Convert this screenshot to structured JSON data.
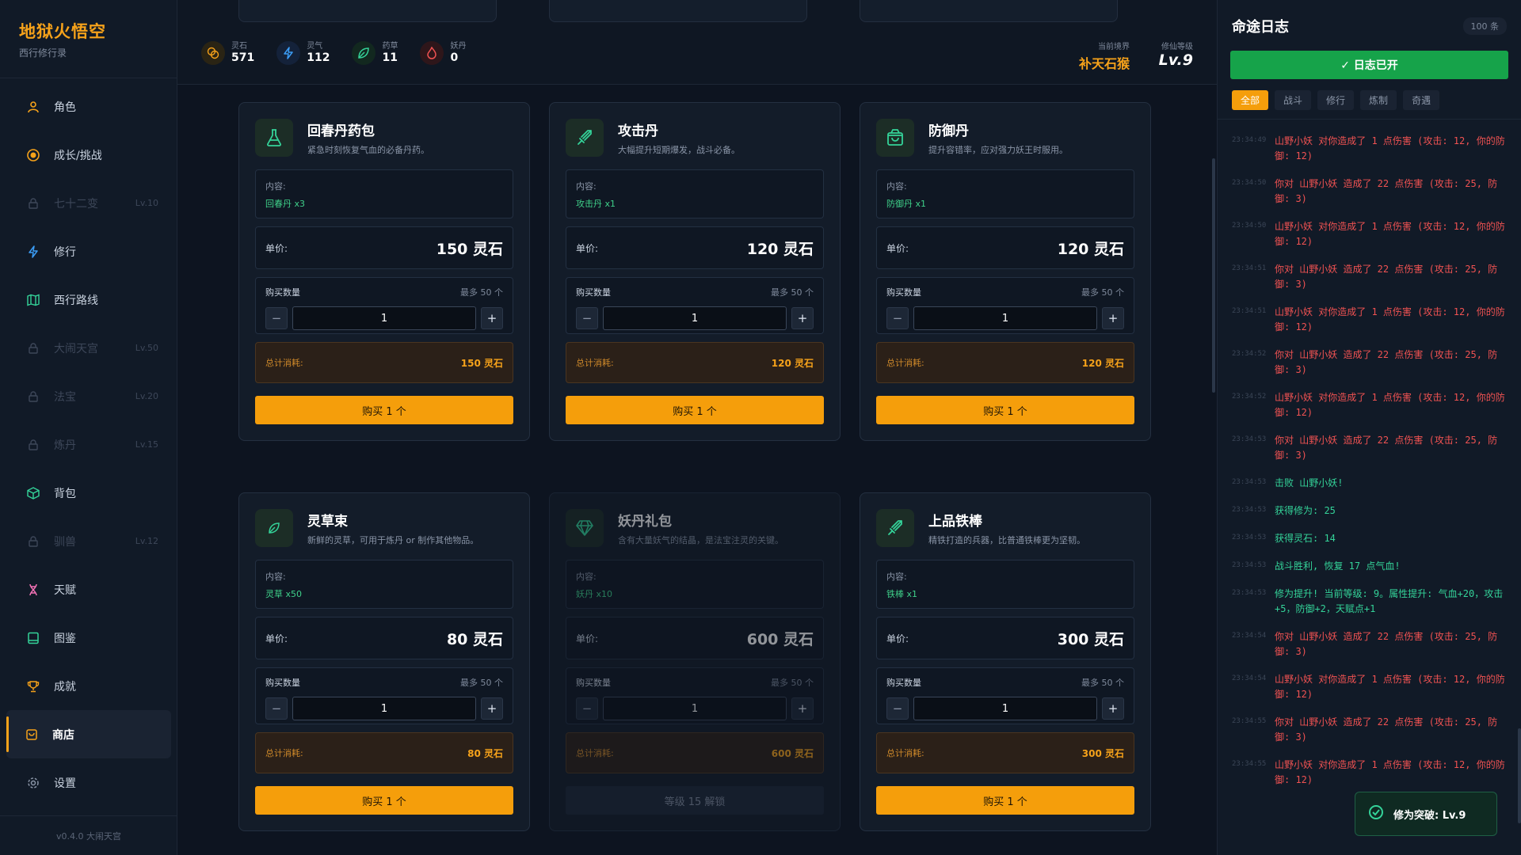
{
  "app": {
    "title": "地狱火悟空",
    "subtitle": "西行修行录",
    "version": "v0.4.0 大闹天宫"
  },
  "nav": [
    {
      "label": "角色",
      "icon": "user-icon",
      "locked": false,
      "level": "",
      "color": "#f6a21a"
    },
    {
      "label": "成长/挑战",
      "icon": "target-icon",
      "locked": false,
      "level": "",
      "color": "#f6a21a"
    },
    {
      "label": "七十二变",
      "icon": "lock-icon",
      "locked": true,
      "level": "Lv.10",
      "color": "#3d4759"
    },
    {
      "label": "修行",
      "icon": "lightning-icon",
      "locked": false,
      "level": "",
      "color": "#3b9cf5"
    },
    {
      "label": "西行路线",
      "icon": "map-icon",
      "locked": false,
      "level": "",
      "color": "#34d399"
    },
    {
      "label": "大闹天宫",
      "icon": "lock-icon",
      "locked": true,
      "level": "Lv.50",
      "color": "#3d4759"
    },
    {
      "label": "法宝",
      "icon": "lock-icon",
      "locked": true,
      "level": "Lv.20",
      "color": "#3d4759"
    },
    {
      "label": "炼丹",
      "icon": "lock-icon",
      "locked": true,
      "level": "Lv.15",
      "color": "#3d4759"
    },
    {
      "label": "背包",
      "icon": "box-icon",
      "locked": false,
      "level": "",
      "color": "#34d399"
    },
    {
      "label": "驯兽",
      "icon": "lock-icon",
      "locked": true,
      "level": "Lv.12",
      "color": "#3d4759"
    },
    {
      "label": "天赋",
      "icon": "dna-icon",
      "locked": false,
      "level": "",
      "color": "#f472b6"
    },
    {
      "label": "图鉴",
      "icon": "book-icon",
      "locked": false,
      "level": "",
      "color": "#34d399"
    },
    {
      "label": "成就",
      "icon": "trophy-icon",
      "locked": false,
      "level": "",
      "color": "#f6a21a"
    },
    {
      "label": "商店",
      "icon": "shop-icon",
      "locked": false,
      "level": "",
      "color": "#f6a21a",
      "active": true
    },
    {
      "label": "设置",
      "icon": "gear-icon",
      "locked": false,
      "level": "",
      "color": "#8a95a7"
    }
  ],
  "resources": [
    {
      "label": "灵石",
      "value": "571",
      "icon": "coin-icon",
      "color": "#f6a21a",
      "bg": "#2a2414"
    },
    {
      "label": "灵气",
      "value": "112",
      "icon": "lightning-icon",
      "color": "#3b9cf5",
      "bg": "#14223a"
    },
    {
      "label": "药草",
      "value": "11",
      "icon": "leaf-icon",
      "color": "#34d399",
      "bg": "#12281f"
    },
    {
      "label": "妖丹",
      "value": "0",
      "icon": "flame-icon",
      "color": "#f05252",
      "bg": "#2e161a"
    }
  ],
  "realm": {
    "label": "当前境界",
    "value": "补天石猴"
  },
  "cultivation": {
    "label": "修仙等级",
    "value": "Lv.9"
  },
  "shop_labels": {
    "content": "内容:",
    "price": "单价:",
    "qty": "购买数量",
    "max": "最多 50 个",
    "total": "总计消耗:",
    "currency": "灵石"
  },
  "items": [
    {
      "name": "回春丹药包",
      "desc": "紧急时刻恢复气血的必备丹药。",
      "content": "回春丹 x3",
      "price": "150 灵石",
      "qty": "1",
      "total": "150 灵石",
      "buy": "购买 1 个",
      "icon": "flask-icon",
      "locked": false
    },
    {
      "name": "攻击丹",
      "desc": "大幅提升短期爆发，战斗必备。",
      "content": "攻击丹 x1",
      "price": "120 灵石",
      "qty": "1",
      "total": "120 灵石",
      "buy": "购买 1 个",
      "icon": "sword-icon",
      "locked": false
    },
    {
      "name": "防御丹",
      "desc": "提升容错率，应对强力妖王时服用。",
      "content": "防御丹 x1",
      "price": "120 灵石",
      "qty": "1",
      "total": "120 灵石",
      "buy": "购买 1 个",
      "icon": "bag-icon",
      "locked": false
    },
    {
      "name": "灵草束",
      "desc": "新鲜的灵草，可用于炼丹 or 制作其他物品。",
      "content": "灵草 x50",
      "price": "80 灵石",
      "qty": "1",
      "total": "80 灵石",
      "buy": "购买 1 个",
      "icon": "leaf-icon",
      "locked": false
    },
    {
      "name": "妖丹礼包",
      "desc": "含有大量妖气的结晶，是法宝注灵的关键。",
      "content": "妖丹 x10",
      "price": "600 灵石",
      "qty": "1",
      "total": "600 灵石",
      "buy": "等级 15 解锁",
      "icon": "gem-icon",
      "locked": true
    },
    {
      "name": "上品铁棒",
      "desc": "精铁打造的兵器，比普通铁棒更为坚韧。",
      "content": "铁棒 x1",
      "price": "300 灵石",
      "qty": "1",
      "total": "300 灵石",
      "buy": "购买 1 个",
      "icon": "sword-icon",
      "locked": false
    }
  ],
  "log": {
    "title": "命途日志",
    "count": "100 条",
    "toggle": "✓ 日志已开",
    "tabs": [
      "全部",
      "战斗",
      "修行",
      "炼制",
      "奇遇"
    ],
    "entries": [
      {
        "time": "23:34:49",
        "text": "山野小妖 对你造成了 1 点伤害 (攻击: 12, 你的防御: 12)",
        "color": "red"
      },
      {
        "time": "23:34:50",
        "text": "你对 山野小妖 造成了 22 点伤害 (攻击: 25, 防御: 3)",
        "color": "red"
      },
      {
        "time": "23:34:50",
        "text": "山野小妖 对你造成了 1 点伤害 (攻击: 12, 你的防御: 12)",
        "color": "red"
      },
      {
        "time": "23:34:51",
        "text": "你对 山野小妖 造成了 22 点伤害 (攻击: 25, 防御: 3)",
        "color": "red"
      },
      {
        "time": "23:34:51",
        "text": "山野小妖 对你造成了 1 点伤害 (攻击: 12, 你的防御: 12)",
        "color": "red"
      },
      {
        "time": "23:34:52",
        "text": "你对 山野小妖 造成了 22 点伤害 (攻击: 25, 防御: 3)",
        "color": "red"
      },
      {
        "time": "23:34:52",
        "text": "山野小妖 对你造成了 1 点伤害 (攻击: 12, 你的防御: 12)",
        "color": "red"
      },
      {
        "time": "23:34:53",
        "text": "你对 山野小妖 造成了 22 点伤害 (攻击: 25, 防御: 3)",
        "color": "red"
      },
      {
        "time": "23:34:53",
        "text": "击败 山野小妖!",
        "color": "green"
      },
      {
        "time": "23:34:53",
        "text": "获得修为: 25",
        "color": "green"
      },
      {
        "time": "23:34:53",
        "text": "获得灵石: 14",
        "color": "green"
      },
      {
        "time": "23:34:53",
        "text": "战斗胜利, 恢复 17 点气血!",
        "color": "green"
      },
      {
        "time": "23:34:53",
        "text": "修为提升! 当前等级: 9。属性提升: 气血+20，攻击+5，防御+2，天赋点+1",
        "color": "green"
      },
      {
        "time": "23:34:54",
        "text": "你对 山野小妖 造成了 22 点伤害 (攻击: 25, 防御: 3)",
        "color": "red"
      },
      {
        "time": "23:34:54",
        "text": "山野小妖 对你造成了 1 点伤害 (攻击: 12, 你的防御: 12)",
        "color": "red"
      },
      {
        "time": "23:34:55",
        "text": "你对 山野小妖 造成了 22 点伤害 (攻击: 25, 防御: 3)",
        "color": "red"
      },
      {
        "time": "23:34:55",
        "text": "山野小妖 对你造成了 1 点伤害 (攻击: 12, 你的防御: 12)",
        "color": "red"
      }
    ]
  },
  "toast": {
    "text": "修为突破: Lv.9"
  }
}
